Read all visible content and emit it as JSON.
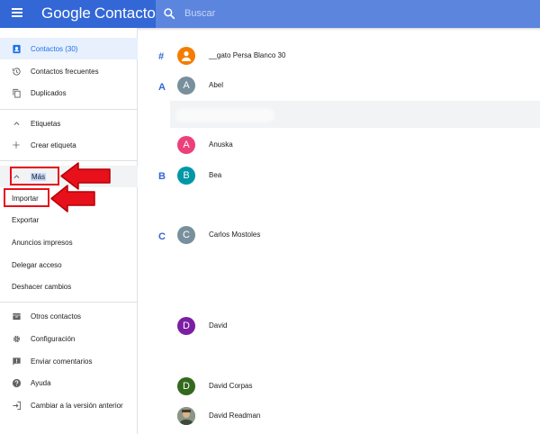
{
  "header": {
    "brand_google": "Google",
    "brand_product": "Contactos",
    "search_placeholder": "Buscar",
    "colors": {
      "bar": "#3367d6",
      "search": "#5c85de"
    }
  },
  "sidebar": {
    "items": [
      {
        "label": "Contactos (30)",
        "icon": "person-icon",
        "active": true
      },
      {
        "label": "Contactos frecuentes",
        "icon": "history-icon"
      },
      {
        "label": "Duplicados",
        "icon": "copy-icon"
      },
      {
        "label": "Etiquetas",
        "icon": "chevron-up-icon"
      },
      {
        "label": "Crear etiqueta",
        "icon": "plus-icon"
      },
      {
        "label": "Más",
        "icon": "chevron-up-icon"
      },
      {
        "label": "Importar"
      },
      {
        "label": "Exportar"
      },
      {
        "label": "Anuncios impresos"
      },
      {
        "label": "Delegar acceso"
      },
      {
        "label": "Deshacer cambios"
      },
      {
        "label": "Otros contactos",
        "icon": "archive-icon"
      },
      {
        "label": "Configuración",
        "icon": "gear-icon"
      },
      {
        "label": "Enviar comentarios",
        "icon": "feedback-icon"
      },
      {
        "label": "Ayuda",
        "icon": "help-icon"
      },
      {
        "label": "Cambiar a la versión anterior",
        "icon": "exit-icon"
      }
    ]
  },
  "contacts": {
    "letters": [
      "#",
      "A",
      "B",
      "C"
    ],
    "rows": [
      {
        "initial": "",
        "name": "__gato Persa Blanco 30",
        "color": "#f57c00"
      },
      {
        "initial": "A",
        "name": "Abel",
        "color": "#78909c"
      },
      {
        "initial": "A",
        "name": "Anuska",
        "color": "#ec407a"
      },
      {
        "initial": "B",
        "name": "Bea",
        "color": "#0097a7"
      },
      {
        "initial": "C",
        "name": "Carlos Mostoles",
        "color": "#78909c"
      },
      {
        "initial": "D",
        "name": "David",
        "color": "#7b1fa2"
      },
      {
        "initial": "D",
        "name": "David Corpas",
        "color": "#33691e"
      },
      {
        "initial": "",
        "name": "David Readman",
        "color": "#6d7b6a"
      }
    ]
  },
  "annotations": {
    "color": "#e8101a"
  }
}
